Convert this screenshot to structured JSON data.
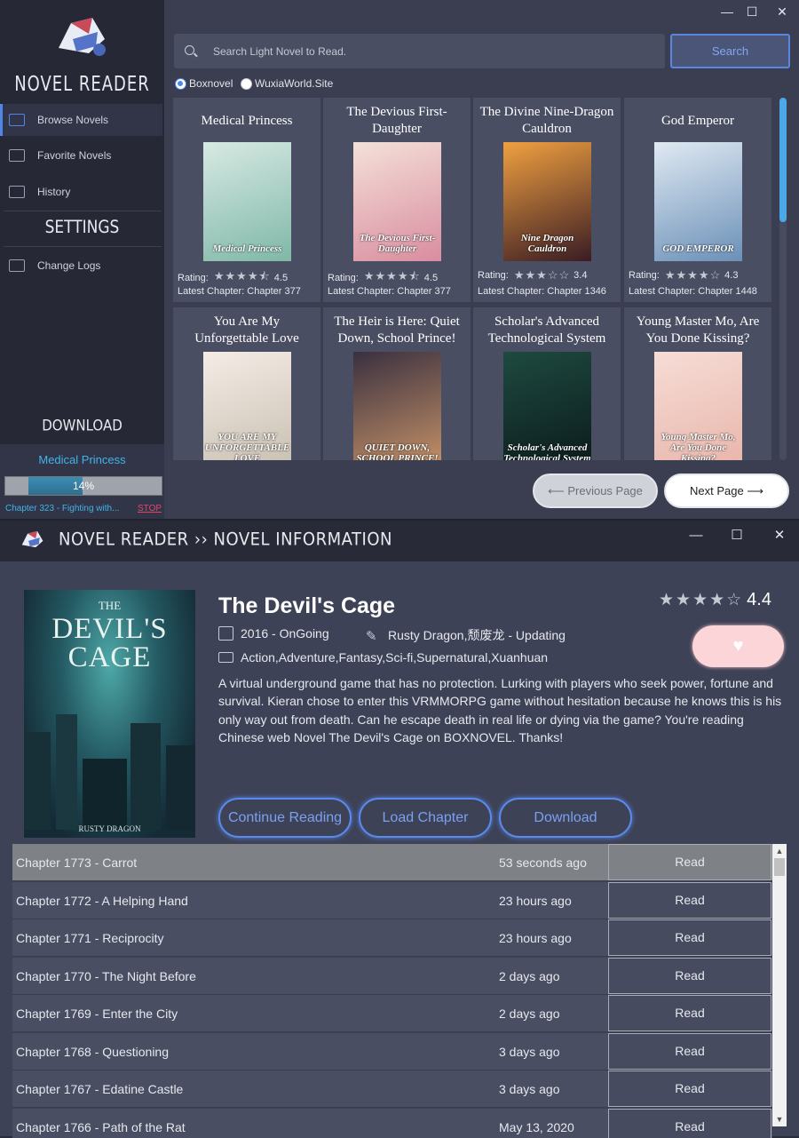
{
  "app": {
    "brand": "NOVEL READER",
    "nav": [
      {
        "label": "Browse Novels",
        "icon": "browse-icon"
      },
      {
        "label": "Favorite Novels",
        "icon": "favorite-icon"
      },
      {
        "label": "History",
        "icon": "history-icon"
      }
    ],
    "settings_title": "SETTINGS",
    "settings_items": [
      {
        "label": "Change Logs",
        "icon": "changelog-icon"
      }
    ],
    "download_title": "DOWNLOAD",
    "download": {
      "novel": "Medical Princess",
      "percent": "14%",
      "progress": 0.14,
      "chapter": "Chapter 323 - Fighting with...",
      "stop": "STOP"
    }
  },
  "browse": {
    "search_placeholder": "Search Light Novel to Read.",
    "search_button": "Search",
    "sources": [
      {
        "label": "Boxnovel",
        "selected": true
      },
      {
        "label": "WuxiaWorld.Site",
        "selected": false
      }
    ],
    "novels": [
      {
        "title": "Medical Princess",
        "cover_text": "Medical Princess",
        "rating_label": "Rating:",
        "stars": "★★★★⯪",
        "rating": "4.5",
        "latest": "Latest Chapter: Chapter 377",
        "colors": [
          "#d7e9e3",
          "#7fb8a8"
        ]
      },
      {
        "title": "The Devious First-Daughter",
        "cover_text": "The Devious First-Daughter",
        "rating_label": "Rating:",
        "stars": "★★★★⯪",
        "rating": "4.5",
        "latest": "Latest Chapter: Chapter 377",
        "colors": [
          "#f4e0d8",
          "#d98da0"
        ]
      },
      {
        "title": "The Divine Nine-Dragon Cauldron",
        "cover_text": "Nine Dragon Cauldron",
        "rating_label": "Rating:",
        "stars": "★★★☆☆",
        "rating": "3.4",
        "latest": "Latest Chapter: Chapter 1346",
        "colors": [
          "#f0a040",
          "#3a1c24"
        ]
      },
      {
        "title": "God Emperor",
        "cover_text": "GOD EMPEROR",
        "rating_label": "Rating:",
        "stars": "★★★★☆",
        "rating": "4.3",
        "latest": "Latest Chapter: Chapter 1448",
        "colors": [
          "#dfe9f2",
          "#6b90b8"
        ]
      },
      {
        "title": "You Are My Unforgettable Love",
        "cover_text": "YOU ARE MY UNFORGETTABLE LOVE",
        "rating_label": "",
        "stars": "",
        "rating": "",
        "latest": "",
        "colors": [
          "#f5ece6",
          "#c7bfb0"
        ]
      },
      {
        "title": "The Heir is Here: Quiet Down, School Prince!",
        "cover_text": "QUIET DOWN, SCHOOL PRINCE!",
        "rating_label": "",
        "stars": "",
        "rating": "",
        "latest": "",
        "colors": [
          "#3a3040",
          "#c89468"
        ]
      },
      {
        "title": "Scholar's Advanced Technological System",
        "cover_text": "Scholar's Advanced Technological System",
        "rating_label": "",
        "stars": "",
        "rating": "",
        "latest": "",
        "colors": [
          "#1e4a40",
          "#0b1a1a"
        ]
      },
      {
        "title": "Young Master Mo, Are You Done Kissing?",
        "cover_text": "Young Master Mo, Are You Done Kissing?",
        "rating_label": "",
        "stars": "",
        "rating": "",
        "latest": "",
        "colors": [
          "#f6ddd6",
          "#e8b4aa"
        ]
      }
    ],
    "prev_label": "⟵ Previous Page",
    "next_label": "Next Page ⟶"
  },
  "info": {
    "breadcrumb": "NOVEL READER ›› NOVEL INFORMATION",
    "cover_small": "THE",
    "cover_title": "DEVIL'S CAGE",
    "cover_author": "RUSTY DRAGON",
    "title": "The Devil's Cage",
    "year_status": "2016 - OnGoing",
    "author_status": "Rusty Dragon,颓废龙 - Updating",
    "genres": "Action,Adventure,Fantasy,Sci-fi,Supernatural,Xuanhuan",
    "stars": "★★★★☆",
    "rating": "4.4",
    "favorite": "♥",
    "description": "A virtual underground game that has no protection. Lurking with players who seek power, fortune and survival. Kieran chose to enter this VRMMORPG game without hesitation because he knows this is his only way out from death. Can he escape death in real life or dying via the game? You're reading Chinese web Novel  The Devil's Cage on BOXNOVEL. Thanks!",
    "buttons": {
      "continue": "Continue Reading",
      "load": "Load Chapter",
      "download": "Download"
    },
    "chapters": [
      {
        "name": "Chapter 1773 - Carrot",
        "time": "53 seconds ago",
        "action": "Read"
      },
      {
        "name": "Chapter 1772 - A Helping Hand",
        "time": "23 hours ago",
        "action": "Read"
      },
      {
        "name": "Chapter 1771 - Reciprocity",
        "time": "23 hours ago",
        "action": "Read"
      },
      {
        "name": "Chapter 1770 - The Night Before",
        "time": "2 days ago",
        "action": "Read"
      },
      {
        "name": "Chapter 1769 - Enter the City",
        "time": "2 days ago",
        "action": "Read"
      },
      {
        "name": "Chapter 1768 - Questioning",
        "time": "3 days ago",
        "action": "Read"
      },
      {
        "name": "Chapter 1767 - Edatine Castle",
        "time": "3 days ago",
        "action": "Read"
      },
      {
        "name": "Chapter 1766 - Path of the Rat",
        "time": "May 13, 2020",
        "action": "Read"
      }
    ]
  },
  "window": {
    "minimize": "—",
    "maximize": "☐",
    "close": "✕"
  }
}
